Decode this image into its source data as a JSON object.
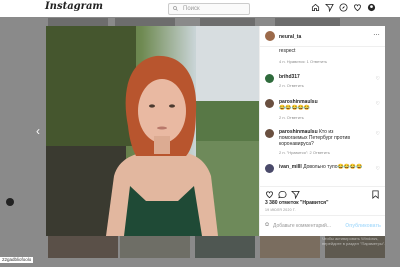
{
  "topbar": {
    "logo": "Instagram",
    "search_placeholder": "Поиск",
    "nav_icons": [
      "home-icon",
      "direct-icon",
      "explore-icon",
      "heart-icon",
      "profile-icon"
    ]
  },
  "post": {
    "author": "neural_ta",
    "caption": "respect",
    "caption_meta": "4 н.   Нравится: 1   Ответить",
    "comments": [
      {
        "user": "brihd317",
        "text": "",
        "meta": "2 н.   Ответить"
      },
      {
        "user": "paroshinmaulsu",
        "text": "😂😂😂😂😂",
        "meta": "2 н.   Ответить"
      },
      {
        "user": "paroshinmaulsu",
        "text": "Кто из помогаемых Петербург против коронавируса?",
        "meta": "2 н.   \"Нравится\": 2   Ответить"
      },
      {
        "user": "ivan_milll",
        "text": "Довольно тупо😂😂😂😂",
        "meta": ""
      }
    ],
    "likes_count": "3 380",
    "likes_label": "отметок \"Нравится\"",
    "date": "19 ИЮЛЯ 2020 Г.",
    "comment_placeholder": "Добавьте комментарий...",
    "post_button": "Опубликовать"
  },
  "watermark": {
    "line1": "Активация Windows",
    "line2": "Чтобы активировать Windows, перейдите в раздел \"Параметры\"."
  },
  "credit": "22gadbliofoolo"
}
